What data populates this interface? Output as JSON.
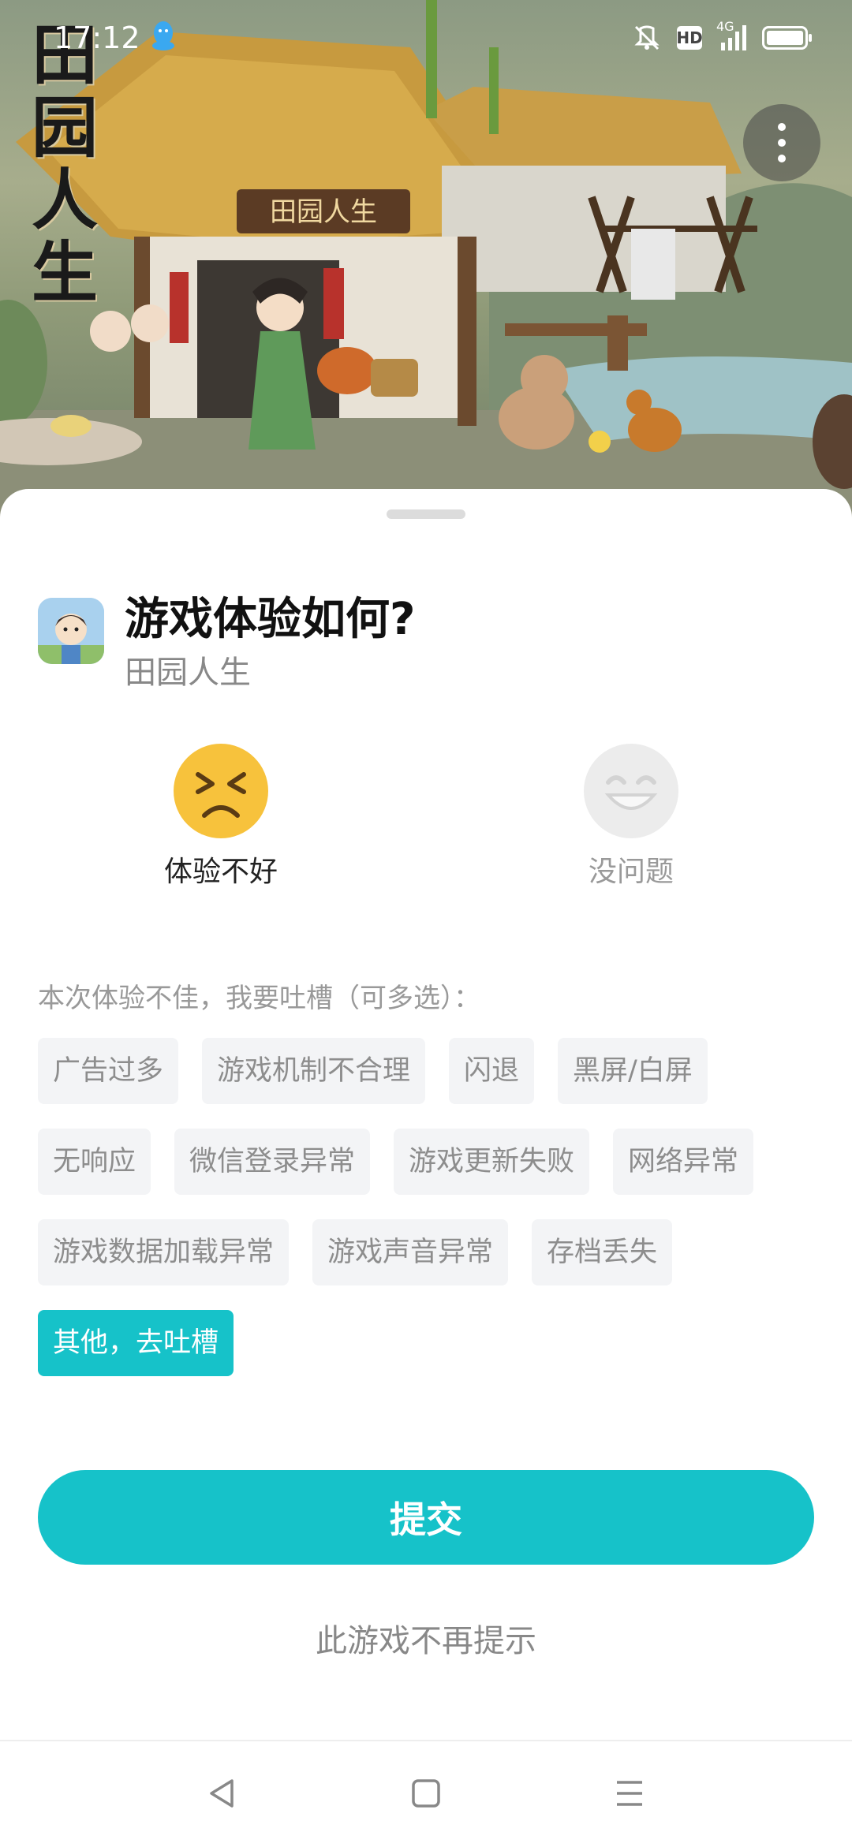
{
  "status_bar": {
    "time": "17:12",
    "network": "4G",
    "hd": "HD",
    "icons": [
      "qq-icon",
      "mute-icon",
      "hd-icon",
      "signal-icon",
      "battery-icon"
    ]
  },
  "game": {
    "logo_text": "田园人生",
    "sign_text": "田园人生"
  },
  "sheet": {
    "title": "游戏体验如何?",
    "game_name": "田园人生",
    "ratings": [
      {
        "label": "体验不好",
        "icon": "disappointed-face-icon",
        "selected": true
      },
      {
        "label": "没问题",
        "icon": "grinning-face-icon",
        "selected": false
      }
    ],
    "prompt": "本次体验不佳，我要吐槽（可多选）：",
    "tags": [
      [
        "广告过多",
        "游戏机制不合理",
        "闪退",
        "黑屏/白屏"
      ],
      [
        "无响应",
        "微信登录异常",
        "游戏更新失败",
        "网络异常"
      ],
      [
        "游戏数据加载异常",
        "游戏声音异常",
        "存档丢失"
      ],
      [
        "其他，去吐槽"
      ]
    ],
    "active_tag": "其他，去吐槽",
    "submit_label": "提交",
    "no_remind_label": "此游戏不再提示"
  },
  "colors": {
    "accent": "#16c2c9",
    "tag_bg": "#f3f4f6",
    "tag_text": "#8d8d8d"
  },
  "nav_bar": {
    "icons": [
      "back-icon",
      "home-icon",
      "menu-icon"
    ]
  }
}
